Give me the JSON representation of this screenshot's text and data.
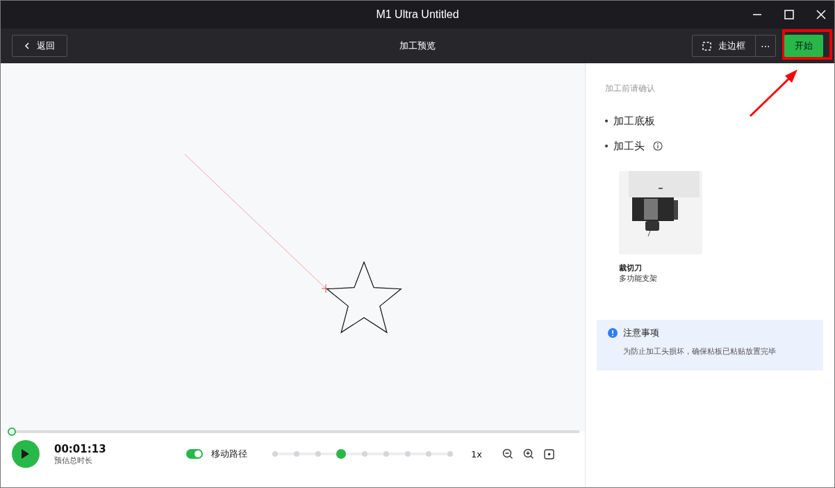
{
  "window": {
    "title": "M1 Ultra Untitled"
  },
  "toolbar": {
    "back": "返回",
    "title": "加工预览",
    "frame": "走边框",
    "more": "⋯",
    "start": "开始"
  },
  "panel": {
    "heading": "加工前请确认",
    "checklist": [
      {
        "label": "加工底板",
        "info": false
      },
      {
        "label": "加工头",
        "info": true
      }
    ],
    "tool": {
      "name": "裁切刀",
      "subtitle": "多功能支架"
    },
    "notice": {
      "title": "注意事项",
      "text": "为防止加工头损坏，确保粘板已粘贴放置完毕"
    }
  },
  "playback": {
    "progress": {
      "level": 0
    },
    "time": "00:01:13",
    "time_label": "预估总时长",
    "path_toggle": {
      "label": "移动路径",
      "on": true
    },
    "speed": {
      "level": 0.375
    },
    "speed_label": "1x"
  }
}
